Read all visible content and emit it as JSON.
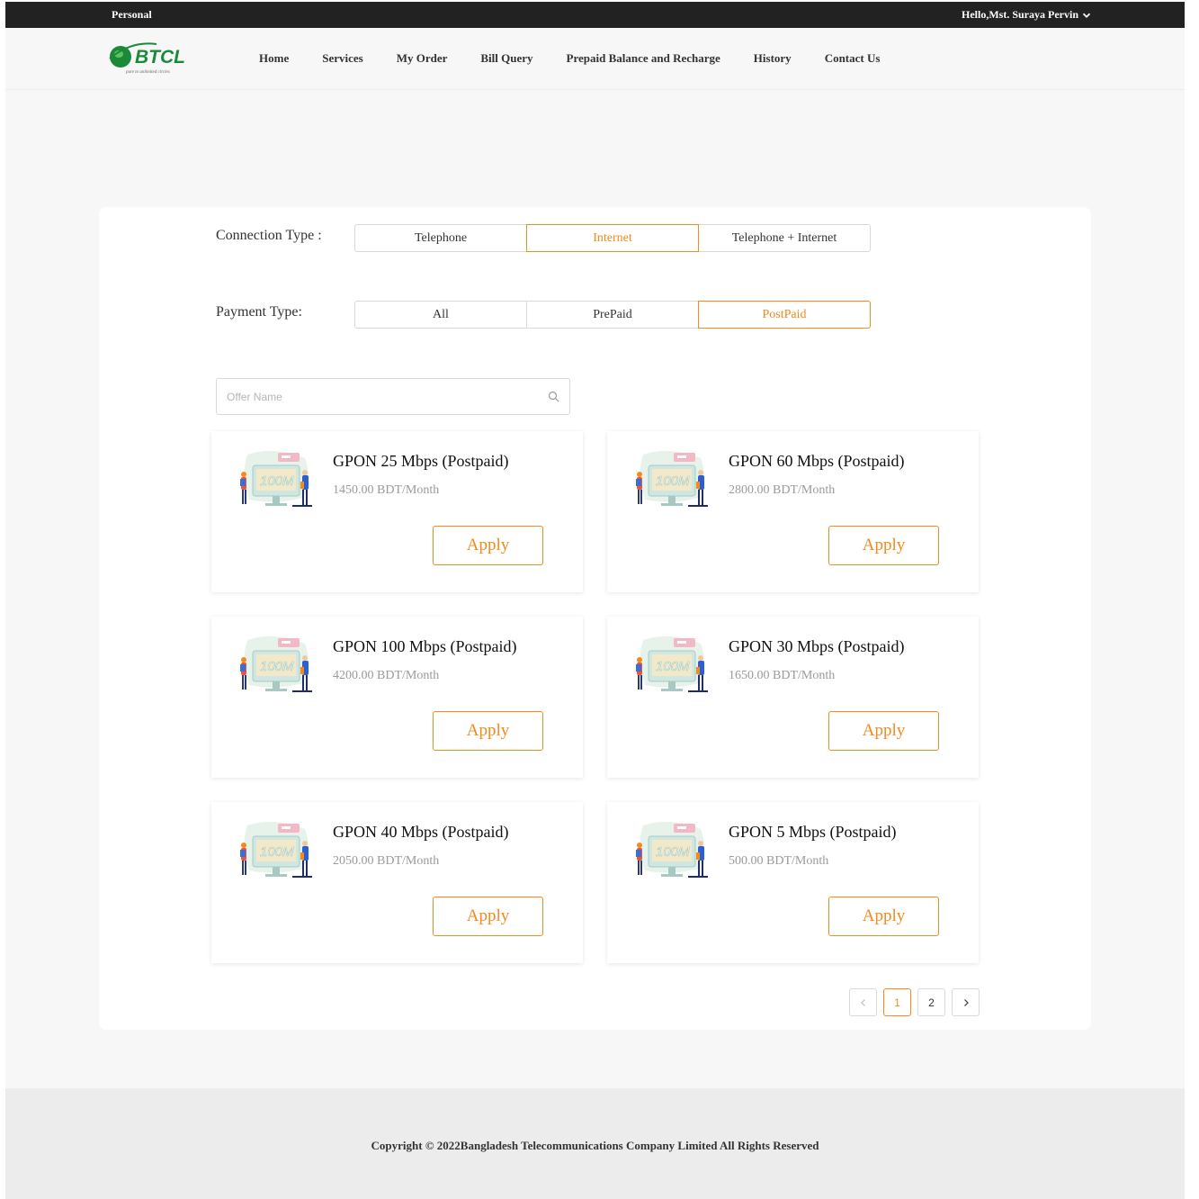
{
  "topbar": {
    "personal": "Personal",
    "greeting": "Hello,Mst. Suraya Pervin"
  },
  "brand": {
    "name": "BTCL",
    "tagline": "pure to unlimited circles",
    "color": "#1a8a3a"
  },
  "nav": {
    "items": [
      "Home",
      "Services",
      "My Order",
      "Bill Query",
      "Prepaid Balance and Recharge",
      "History",
      "Contact Us"
    ]
  },
  "filters": {
    "connection_label": "Connection Type :",
    "connection_options": [
      "Telephone",
      "Internet",
      "Telephone + Internet"
    ],
    "connection_selected": "Internet",
    "payment_label": "Payment Type:",
    "payment_options": [
      "All",
      "PrePaid",
      "PostPaid"
    ],
    "payment_selected": "PostPaid"
  },
  "search": {
    "placeholder": "Offer Name",
    "value": ""
  },
  "illustration_badge": "100M",
  "offers": [
    {
      "name": "GPON 25 Mbps (Postpaid)",
      "price": "1450.00 BDT/Month",
      "action": "Apply"
    },
    {
      "name": "GPON 60 Mbps (Postpaid)",
      "price": "2800.00 BDT/Month",
      "action": "Apply"
    },
    {
      "name": "GPON 100 Mbps (Postpaid)",
      "price": "4200.00 BDT/Month",
      "action": "Apply"
    },
    {
      "name": "GPON 30 Mbps (Postpaid)",
      "price": "1650.00 BDT/Month",
      "action": "Apply"
    },
    {
      "name": "GPON 40 Mbps (Postpaid)",
      "price": "2050.00 BDT/Month",
      "action": "Apply"
    },
    {
      "name": "GPON 5 Mbps (Postpaid)",
      "price": "500.00 BDT/Month",
      "action": "Apply"
    }
  ],
  "pagination": {
    "pages": [
      "1",
      "2"
    ],
    "current": "1"
  },
  "footer": {
    "copyright": "Copyright © 2022Bangladesh Telecommunications Company Limited All Rights Reserved"
  },
  "colors": {
    "accent": "#f28a1c",
    "topbar": "#222222",
    "background": "#f7f7f7"
  }
}
